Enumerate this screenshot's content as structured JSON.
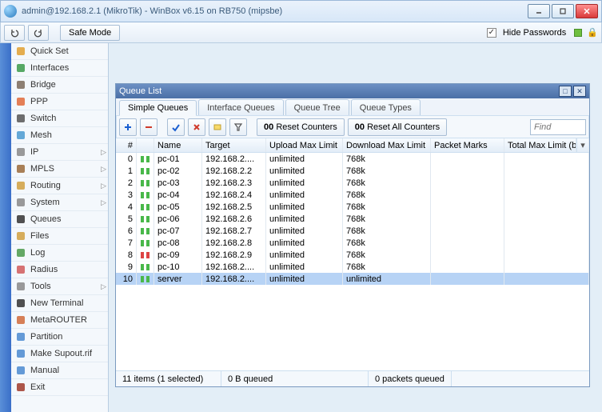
{
  "titlebar": {
    "title": "admin@192.168.2.1 (MikroTik) - WinBox v6.15 on RB750 (mipsbe)"
  },
  "toolbar": {
    "safe_mode": "Safe Mode",
    "hide_passwords": "Hide Passwords"
  },
  "sidebar": {
    "items": [
      {
        "label": "Quick Set",
        "icon": "wizard-icon"
      },
      {
        "label": "Interfaces",
        "icon": "interfaces-icon"
      },
      {
        "label": "Bridge",
        "icon": "bridge-icon"
      },
      {
        "label": "PPP",
        "icon": "ppp-icon"
      },
      {
        "label": "Switch",
        "icon": "switch-icon"
      },
      {
        "label": "Mesh",
        "icon": "mesh-icon"
      },
      {
        "label": "IP",
        "icon": "ip-icon",
        "submenu": true
      },
      {
        "label": "MPLS",
        "icon": "mpls-icon",
        "submenu": true
      },
      {
        "label": "Routing",
        "icon": "routing-icon",
        "submenu": true
      },
      {
        "label": "System",
        "icon": "system-icon",
        "submenu": true
      },
      {
        "label": "Queues",
        "icon": "queues-icon"
      },
      {
        "label": "Files",
        "icon": "files-icon"
      },
      {
        "label": "Log",
        "icon": "log-icon"
      },
      {
        "label": "Radius",
        "icon": "radius-icon"
      },
      {
        "label": "Tools",
        "icon": "tools-icon",
        "submenu": true
      },
      {
        "label": "New Terminal",
        "icon": "terminal-icon"
      },
      {
        "label": "MetaROUTER",
        "icon": "metarouter-icon"
      },
      {
        "label": "Partition",
        "icon": "partition-icon"
      },
      {
        "label": "Make Supout.rif",
        "icon": "supout-icon"
      },
      {
        "label": "Manual",
        "icon": "manual-icon"
      },
      {
        "label": "Exit",
        "icon": "exit-icon"
      }
    ]
  },
  "inner": {
    "title": "Queue List",
    "tabs": [
      "Simple Queues",
      "Interface Queues",
      "Queue Tree",
      "Queue Types"
    ],
    "active_tab": 0,
    "toolbar": {
      "reset_counters": "Reset Counters",
      "reset_all": "Reset All Counters",
      "counter_prefix": "00",
      "find_placeholder": "Find"
    },
    "columns": [
      "#",
      "",
      "Name",
      "Target",
      "Upload Max Limit",
      "Download Max Limit",
      "Packet Marks",
      "Total Max Limit (bi..."
    ],
    "rows": [
      {
        "n": "0",
        "name": "pc-01",
        "target": "192.168.2....",
        "up": "unlimited",
        "down": "768k",
        "pm": "",
        "color": "green"
      },
      {
        "n": "1",
        "name": "pc-02",
        "target": "192.168.2.2",
        "up": "unlimited",
        "down": "768k",
        "pm": "",
        "color": "green"
      },
      {
        "n": "2",
        "name": "pc-03",
        "target": "192.168.2.3",
        "up": "unlimited",
        "down": "768k",
        "pm": "",
        "color": "green"
      },
      {
        "n": "3",
        "name": "pc-04",
        "target": "192.168.2.4",
        "up": "unlimited",
        "down": "768k",
        "pm": "",
        "color": "green"
      },
      {
        "n": "4",
        "name": "pc-05",
        "target": "192.168.2.5",
        "up": "unlimited",
        "down": "768k",
        "pm": "",
        "color": "green"
      },
      {
        "n": "5",
        "name": "pc-06",
        "target": "192.168.2.6",
        "up": "unlimited",
        "down": "768k",
        "pm": "",
        "color": "green"
      },
      {
        "n": "6",
        "name": "pc-07",
        "target": "192.168.2.7",
        "up": "unlimited",
        "down": "768k",
        "pm": "",
        "color": "green"
      },
      {
        "n": "7",
        "name": "pc-08",
        "target": "192.168.2.8",
        "up": "unlimited",
        "down": "768k",
        "pm": "",
        "color": "green"
      },
      {
        "n": "8",
        "name": "pc-09",
        "target": "192.168.2.9",
        "up": "unlimited",
        "down": "768k",
        "pm": "",
        "color": "red"
      },
      {
        "n": "9",
        "name": "pc-10",
        "target": "192.168.2....",
        "up": "unlimited",
        "down": "768k",
        "pm": "",
        "color": "green"
      },
      {
        "n": "10",
        "name": "server",
        "target": "192.168.2....",
        "up": "unlimited",
        "down": "unlimited",
        "pm": "",
        "color": "green",
        "selected": true
      }
    ],
    "status": {
      "items": "11 items (1 selected)",
      "queued": "0 B queued",
      "packets": "0 packets queued"
    }
  }
}
